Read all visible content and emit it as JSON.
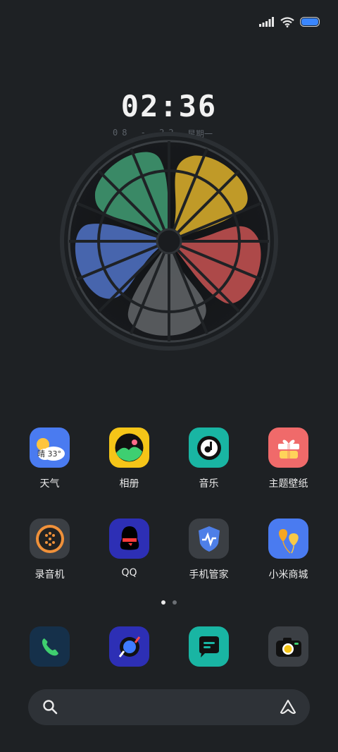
{
  "status_bar": {
    "signal_icon": "signal-icon",
    "wifi_icon": "wifi-icon",
    "battery_icon": "battery-icon",
    "battery_color": "#3a86ff"
  },
  "clock": {
    "time": "02:36",
    "date": "08 - 22",
    "weekday": "星期一"
  },
  "widget": {
    "type": "fan",
    "blade_colors": [
      "#3c8f6a",
      "#c9a129",
      "#b54c4c",
      "#5a5d60",
      "#4a69b5"
    ]
  },
  "row1": [
    {
      "label": "天气",
      "icon": "weather-icon",
      "badge": "晴 33°",
      "color": "#4a7bf0"
    },
    {
      "label": "相册",
      "icon": "gallery-icon",
      "color": "#f5c518"
    },
    {
      "label": "音乐",
      "icon": "music-icon",
      "color": "#19b5a3"
    },
    {
      "label": "主题壁纸",
      "icon": "gift-icon",
      "color": "#f06a6a"
    }
  ],
  "row2": [
    {
      "label": "录音机",
      "icon": "recorder-icon",
      "color": "#3b3f44"
    },
    {
      "label": "QQ",
      "icon": "qq-penguin-icon",
      "color": "#2d2fb5"
    },
    {
      "label": "手机管家",
      "icon": "security-shield-icon",
      "color": "#3b3f44"
    },
    {
      "label": "小米商城",
      "icon": "balloons-icon",
      "color": "#4a7bf0"
    }
  ],
  "dock": [
    {
      "icon": "phone-icon",
      "color": "#15304a"
    },
    {
      "icon": "browser-icon",
      "color": "#2d2fb5"
    },
    {
      "icon": "messages-icon",
      "color": "#19b5a3"
    },
    {
      "icon": "camera-icon",
      "color": "#3b3f44"
    }
  ],
  "page_indicator": {
    "count": 2,
    "active": 1
  },
  "search_bar": {
    "search_icon": "search-icon",
    "assistant_icon": "ai-assistant-icon"
  }
}
